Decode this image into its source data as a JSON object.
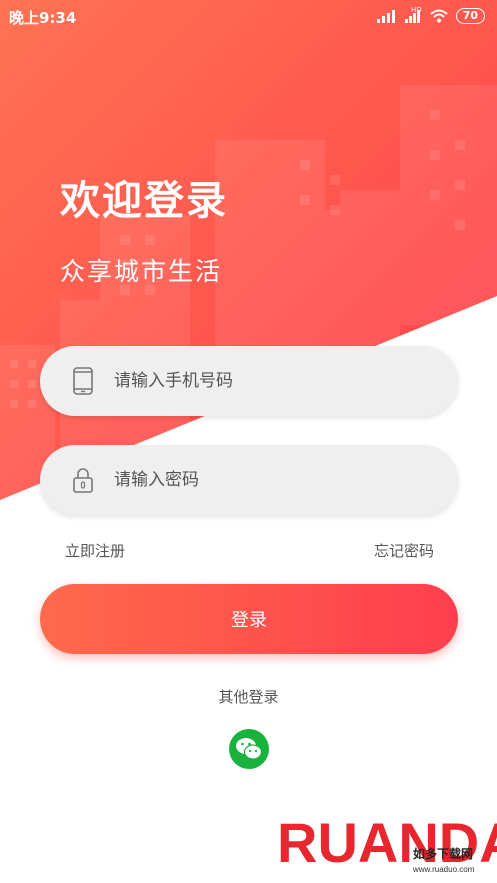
{
  "status_bar": {
    "time": "晚上9:34",
    "network": "HD",
    "battery": "70"
  },
  "header": {
    "title": "欢迎登录",
    "subtitle": "众享城市生活"
  },
  "form": {
    "phone_placeholder": "请输入手机号码",
    "password_placeholder": "请输入密码",
    "register_link": "立即注册",
    "forgot_link": "忘记密码",
    "login_button": "登录"
  },
  "other_login": {
    "label": "其他登录",
    "icon": "wechat-icon"
  },
  "watermark": {
    "text": "RUANDAO",
    "sub": "如多下载网",
    "url": "www.ruaduo.com"
  },
  "colors": {
    "accent_start": "#ff6a4c",
    "accent_end": "#ff3e4d",
    "wechat": "#18b33c"
  }
}
